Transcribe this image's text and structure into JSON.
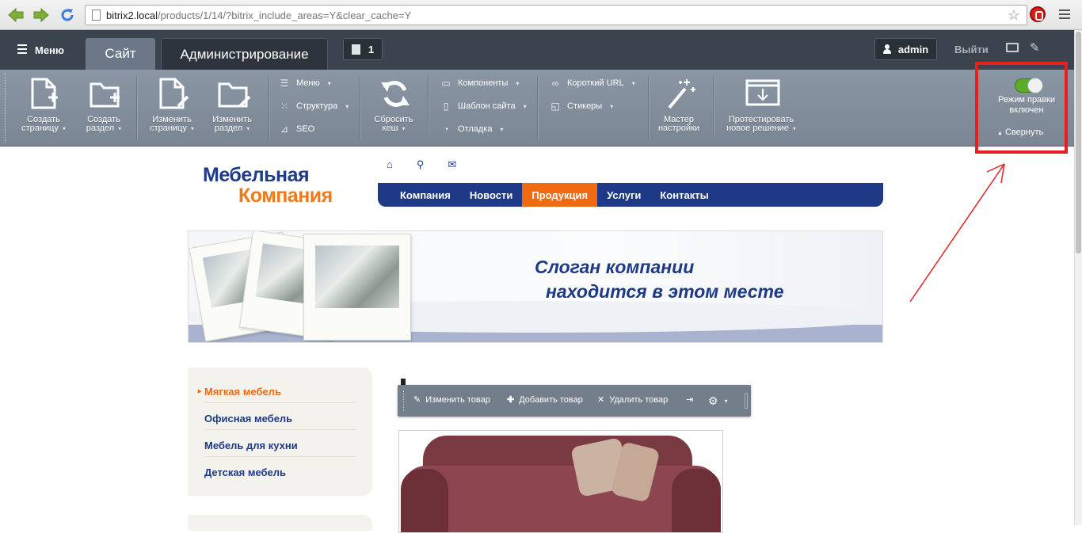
{
  "browser": {
    "url_host": "bitrix2.local",
    "url_path": "/products/1/14/?bitrix_include_areas=Y&clear_cache=Y"
  },
  "panel": {
    "menu_label": "Меню",
    "tab_site": "Сайт",
    "tab_admin": "Администрирование",
    "notifications_count": "1",
    "user_name": "admin",
    "logout_label": "Выйти",
    "buttons": {
      "create_page": [
        "Создать",
        "страницу"
      ],
      "create_section": [
        "Создать",
        "раздел"
      ],
      "edit_page": [
        "Изменить",
        "страницу"
      ],
      "edit_section": [
        "Изменить",
        "раздел"
      ],
      "clear_cache": [
        "Сбросить",
        "кеш"
      ],
      "wizard": [
        "Мастер",
        "настройки"
      ],
      "test_solution": [
        "Протестировать",
        "новое решение"
      ]
    },
    "menus": {
      "menu": "Меню",
      "structure": "Структура",
      "seo": "SEO",
      "components": "Компоненты",
      "template": "Шаблон сайта",
      "debug": "Отладка",
      "short_url": "Короткий URL",
      "stickers": "Стикеры"
    },
    "edit_mode_label_1": "Режим правки",
    "edit_mode_label_2": "включен",
    "edit_mode_on": true,
    "collapse_label": "Свернуть",
    "highlight_color": "#e81f1f"
  },
  "site": {
    "logo_line1": "Мебельная",
    "logo_line2": "Компания",
    "nav": [
      "Компания",
      "Новости",
      "Продукция",
      "Услуги",
      "Контакты"
    ],
    "nav_active": "Продукция",
    "slogan_line1": "Слоган компании",
    "slogan_line2": "находится в этом месте",
    "sidebar": [
      "Мягкая мебель",
      "Офисная мебель",
      "Мебель для кухни",
      "Детская мебель"
    ],
    "sidebar_active": "Мягкая мебель",
    "product_toolbar": {
      "edit": "Изменить товар",
      "add": "Добавить товар",
      "delete": "Удалить товар"
    },
    "colors": {
      "brand_blue": "#1e3a87",
      "brand_orange": "#f26a10"
    }
  }
}
